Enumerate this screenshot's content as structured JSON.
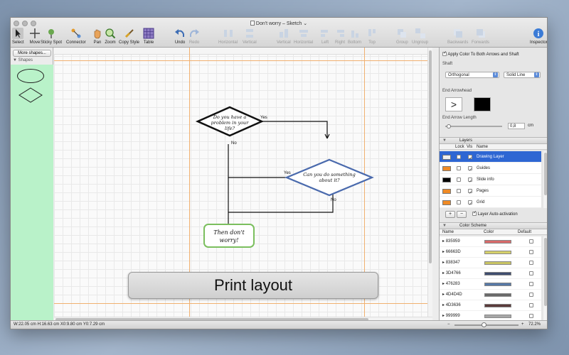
{
  "window": {
    "title": "Don't worry – Sketch"
  },
  "toolbar": {
    "tools": [
      {
        "label": "Select"
      },
      {
        "label": "Move"
      },
      {
        "label": "Sticky Spot"
      },
      {
        "label": "Connector"
      },
      {
        "label": "Pan"
      },
      {
        "label": "Zoom"
      },
      {
        "label": "Copy Style"
      },
      {
        "label": "Table"
      },
      {
        "label": "Undo"
      },
      {
        "label": "Redo"
      },
      {
        "label": "Horizontal"
      },
      {
        "label": "Vertical"
      },
      {
        "label": "Vertical"
      },
      {
        "label": "Horizontal"
      },
      {
        "label": "Left"
      },
      {
        "label": "Right"
      },
      {
        "label": "Bottom"
      },
      {
        "label": "Top"
      },
      {
        "label": "Group"
      },
      {
        "label": "Ungroup"
      },
      {
        "label": "Backwards"
      },
      {
        "label": "Forwards"
      },
      {
        "label": "Inspector"
      }
    ]
  },
  "sidebar": {
    "more_shapes": "More shapes...",
    "shapes_header": "Shapes"
  },
  "canvas": {
    "flowchart": {
      "decision1": "Do you have a problem in your life?",
      "decision1_lines": [
        "Do you have a",
        "problem in your",
        "life?"
      ],
      "decision2_lines": [
        "Can you do something",
        "about it?"
      ],
      "result_lines": [
        "Then don't",
        "worry!"
      ],
      "yes1": "Yes",
      "no1": "No",
      "yes2": "Yes",
      "no2": "No"
    },
    "banner": "Print layout"
  },
  "status": {
    "coords": "W:22.05 cm H:16.63 cm X0:9.80 cm Y0:7.29 cm",
    "zoom": "72.2%"
  },
  "inspector": {
    "apply_both": "Apply Color To Both Arrows and Shaft",
    "shaft_label": "Shaft",
    "shaft_style": "Orthogonal",
    "shaft_line": "Solid Line",
    "end_arrowhead_label": "End Arrowhead",
    "end_arrowhead_glyph": ">",
    "end_arrow_length_label": "End Arrow Length",
    "end_arrow_length_value": "0,8",
    "end_arrow_length_unit": "cm",
    "layers_title": "Layers",
    "layers_cols": {
      "lock": "Lock",
      "vis": "Vis",
      "name": "Name"
    },
    "layers": [
      {
        "name": "Drawing Layer",
        "swatch": "#f0f0f0",
        "selected": true
      },
      {
        "name": "Guides",
        "swatch": "#f08a24",
        "selected": false
      },
      {
        "name": "Slide info",
        "swatch": "#000000",
        "selected": false
      },
      {
        "name": "Pages",
        "swatch": "#f08a24",
        "selected": false
      },
      {
        "name": "Grid",
        "swatch": "#f08a24",
        "selected": false
      }
    ],
    "add_btn": "+",
    "remove_btn": "−",
    "layer_auto": "Layer Auto-activation",
    "color_scheme_title": "Color Scheme",
    "color_cols": {
      "name": "Name",
      "color": "Color",
      "default": "Default"
    },
    "colors": [
      {
        "name": "835959",
        "hex": "#d86a6a"
      },
      {
        "name": "66663D",
        "hex": "#d6d06a"
      },
      {
        "name": "838347",
        "hex": "#c9c463"
      },
      {
        "name": "3D4766",
        "hex": "#3f4d6e"
      },
      {
        "name": "476283",
        "hex": "#5678a6"
      },
      {
        "name": "4D4D4D",
        "hex": "#6a6a6a"
      },
      {
        "name": "4D3636",
        "hex": "#5a3a3a"
      },
      {
        "name": "999999",
        "hex": "#a7a7a7"
      }
    ]
  }
}
